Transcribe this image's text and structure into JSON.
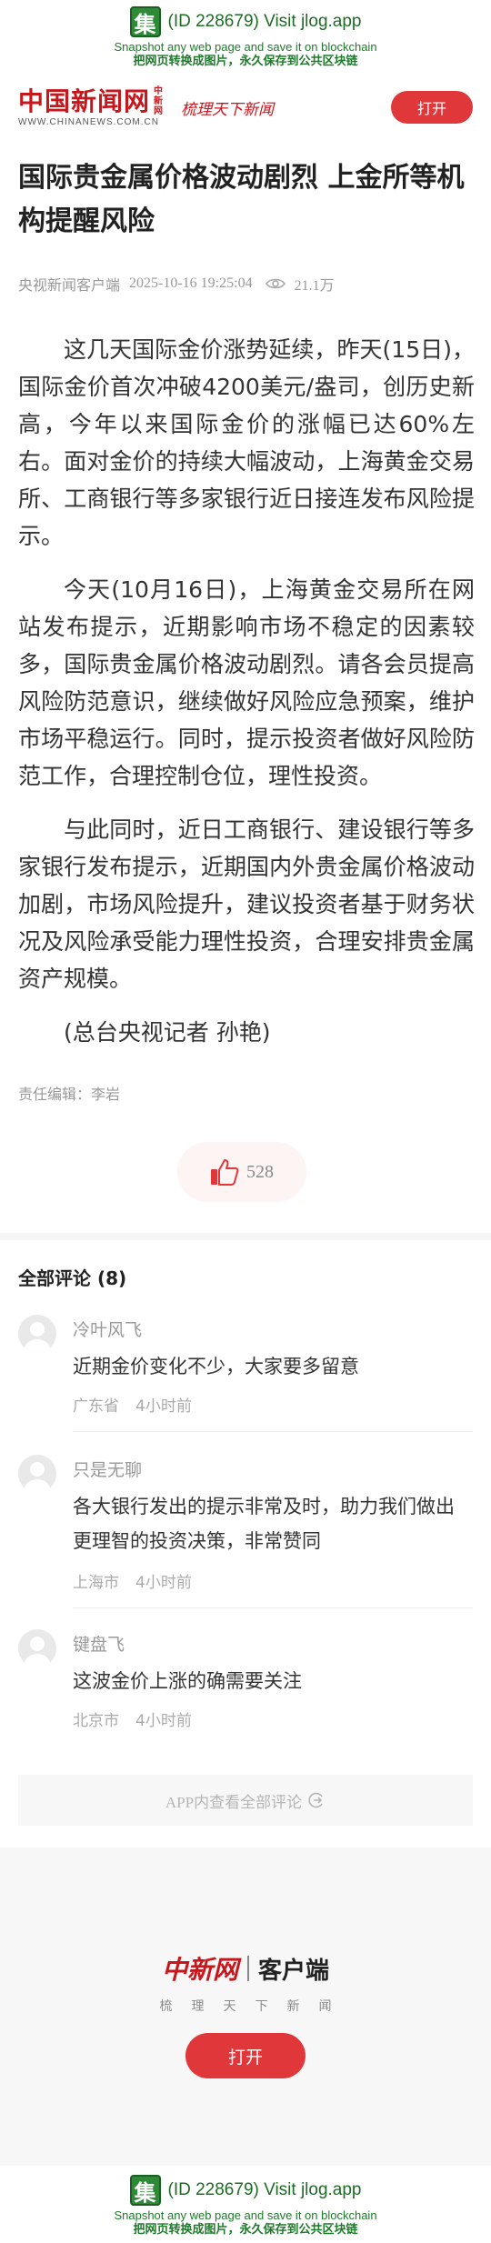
{
  "jlog": {
    "id_text": "(ID 228679) Visit jlog.app",
    "line_en": "Snapshot any web page and save it on blockchain",
    "line_cn": "把网页转换成图片，永久保存到公共区块链",
    "logo_char": "集"
  },
  "header": {
    "brand_cn": "中国新闻网",
    "brand_sub": "中新网",
    "brand_en": "WWW.CHINANEWS.COM.CN",
    "slogan": "梳理天下新闻",
    "open_label": "打开"
  },
  "article": {
    "title": "国际贵金属价格波动剧烈 上金所等机构提醒风险",
    "source": "央视新闻客户端",
    "datetime": "2025-10-16 19:25:04",
    "views": "21.1万",
    "paragraphs": [
      "这几天国际金价涨势延续，昨天(15日)，国际金价首次冲破4200美元/盎司，创历史新高，今年以来国际金价的涨幅已达60%左右。面对金价的持续大幅波动，上海黄金交易所、工商银行等多家银行近日接连发布风险提示。",
      "今天(10月16日)，上海黄金交易所在网站发布提示，近期影响市场不稳定的因素较多，国际贵金属价格波动剧烈。请各会员提高风险防范意识，继续做好风险应急预案，维护市场平稳运行。同时，提示投资者做好风险防范工作，合理控制仓位，理性投资。",
      "与此同时，近日工商银行、建设银行等多家银行发布提示，近期国内外贵金属价格波动加剧，市场风险提升，建议投资者基于财务状况及风险承受能力理性投资，合理安排贵金属资产规模。",
      "(总台央视记者 孙艳)"
    ],
    "editor": "责任编辑：李岩",
    "likes": "528"
  },
  "comments": {
    "title": "全部评论 (8)",
    "items": [
      {
        "name": "冷叶风飞",
        "text": "近期金价变化不少，大家要多留意",
        "location": "广东省",
        "time": "4小时前"
      },
      {
        "name": "只是无聊",
        "text": "各大银行发出的提示非常及时，助力我们做出更理智的投资决策，非常赞同",
        "location": "上海市",
        "time": "4小时前"
      },
      {
        "name": "键盘飞",
        "text": "这波金价上涨的确需要关注",
        "location": "北京市",
        "time": "4小时前"
      }
    ],
    "view_all": "APP内查看全部评论"
  },
  "promo": {
    "brand": "中新网",
    "client": "客户端",
    "slogan": "梳理天下新闻",
    "open_label": "打开"
  },
  "colors": {
    "brand_red": "#c8161d",
    "button_red": "#e0373a",
    "jlog_green": "#2f8a38"
  }
}
